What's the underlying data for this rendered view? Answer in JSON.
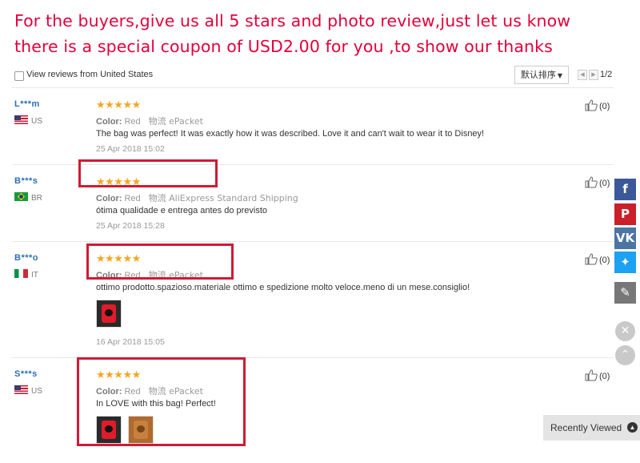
{
  "banner": {
    "line1": "For the buyers,give us all 5 stars and photo review,just let us know",
    "line2": "there is a special coupon of USD2.00 for you ,to show our thanks"
  },
  "toolbar": {
    "filter_label": "View reviews from United States",
    "sort_label": "默认排序",
    "page_indicator": "1/2"
  },
  "reviews": [
    {
      "user": "L***m",
      "country": "US",
      "stars": "★★★★★",
      "rating": 5,
      "color_label": "Color:",
      "color_value": "Red",
      "shipping_label": "物流",
      "shipping_value": "ePacket",
      "text": "The bag was perfect! It was exactly how it was described. Love it and can't wait to wear it to Disney!",
      "date": "25 Apr 2018 15:02",
      "helpful": "(0)"
    },
    {
      "user": "B***s",
      "country": "BR",
      "stars": "★★★★★",
      "rating": 5,
      "color_label": "Color:",
      "color_value": "Red",
      "shipping_label": "物流",
      "shipping_value": "AliExpress Standard Shipping",
      "text": "ótima qualidade e entrega antes do previsto",
      "date": "25 Apr 2018 15:28",
      "helpful": "(0)"
    },
    {
      "user": "B***o",
      "country": "IT",
      "stars": "★★★★★",
      "rating": 5,
      "color_label": "Color:",
      "color_value": "Red",
      "shipping_label": "物流",
      "shipping_value": "ePacket",
      "text": "ottimo prodotto.spazioso.materiale ottimo e spedizione molto veloce.meno di un mese.consiglio!",
      "date": "16 Apr 2018 15:05",
      "helpful": "(0)"
    },
    {
      "user": "S***s",
      "country": "US",
      "stars": "★★★★★",
      "rating": 5,
      "color_label": "Color:",
      "color_value": "Red",
      "shipping_label": "物流",
      "shipping_value": "ePacket",
      "text": "In LOVE with this bag! Perfect!",
      "helpful": "(0)"
    }
  ],
  "recently_viewed": "Recently Viewed",
  "colors": {
    "banner": "#e4003a",
    "stars": "#f5a623",
    "highlight": "#d11a34",
    "username": "#2c6fb7"
  },
  "icons": [
    "thumbs-up-icon",
    "facebook-icon",
    "pinterest-icon",
    "vk-icon",
    "twitter-icon",
    "edit-icon",
    "close-icon",
    "scroll-top-icon"
  ]
}
